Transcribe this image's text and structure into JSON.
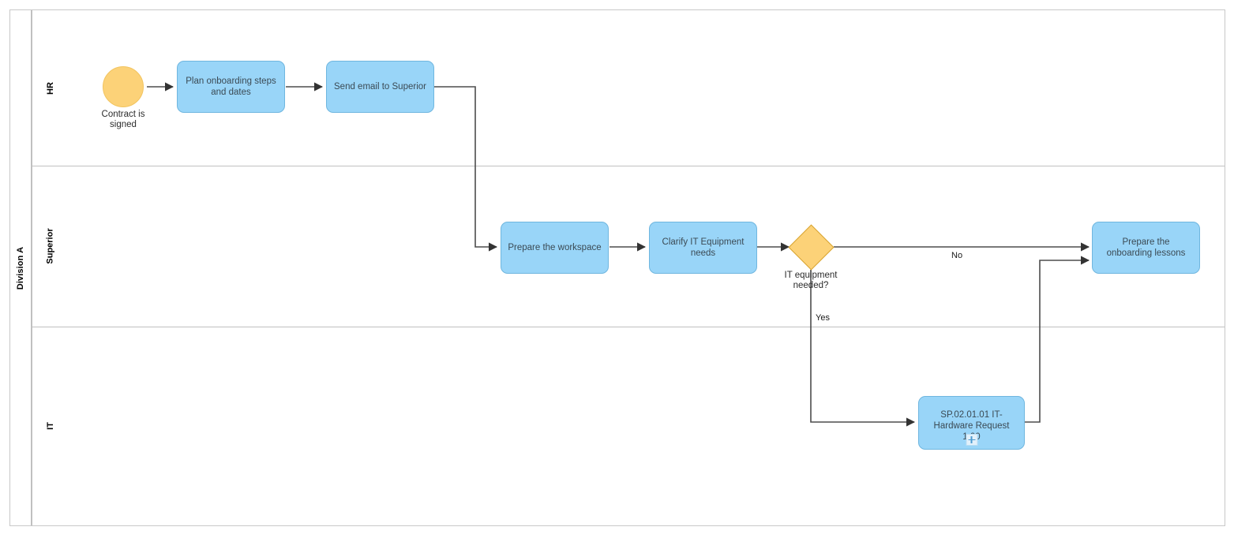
{
  "diagram": {
    "type": "bpmn",
    "pool": {
      "name": "Division A"
    },
    "lanes": [
      {
        "id": "hr",
        "name": "HR"
      },
      {
        "id": "superior",
        "name": "Superior"
      },
      {
        "id": "it",
        "name": "IT"
      }
    ],
    "nodes": {
      "start_event": {
        "type": "start-event",
        "lane": "hr",
        "caption": "Contract is\nsigned",
        "color": "#FCD278"
      },
      "task_plan": {
        "type": "task",
        "lane": "hr",
        "label": "Plan onboarding steps and dates",
        "color": "#99D5F8"
      },
      "task_email": {
        "type": "task",
        "lane": "hr",
        "label": "Send email to Superior",
        "color": "#99D5F8"
      },
      "task_workspace": {
        "type": "task",
        "lane": "superior",
        "label": "Prepare the workspace",
        "color": "#99D5F8"
      },
      "task_clarify": {
        "type": "task",
        "lane": "superior",
        "label": "Clarify IT Equipment needs",
        "color": "#99D5F8"
      },
      "gateway_it": {
        "type": "exclusive-gateway",
        "lane": "superior",
        "caption": "IT equipment\nneeded?",
        "color": "#FCD278"
      },
      "task_lessons": {
        "type": "task",
        "lane": "superior",
        "label": "Prepare the onboarding lessons",
        "color": "#99D5F8"
      },
      "subprocess_hardware": {
        "type": "collapsed-subprocess",
        "lane": "it",
        "label": "SP.02.01.01 IT-Hardware Request 1.00",
        "marker": "plus",
        "color": "#99D5F8"
      }
    },
    "flow_labels": {
      "gateway_no": "No",
      "gateway_yes": "Yes"
    }
  }
}
